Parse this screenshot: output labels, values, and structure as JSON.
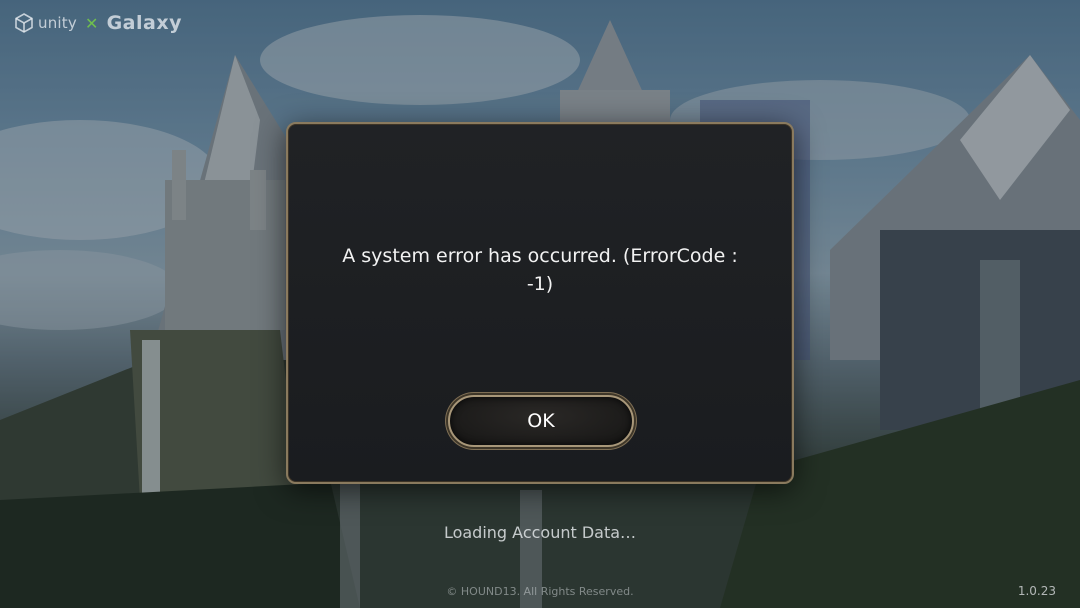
{
  "logo": {
    "unity_text": "unity",
    "separator": "✕",
    "galaxy_text": "Galaxy"
  },
  "dialog": {
    "message_line1": "A system error has occurred. (ErrorCode :",
    "message_line2": "-1)",
    "ok_label": "OK"
  },
  "status": {
    "loading_text": "Loading Account Data…"
  },
  "footer": {
    "copyright": "© HOUND13. All Rights Reserved.",
    "version": "1.0.23"
  },
  "colors": {
    "dialog_border": "#8a7a5e",
    "dialog_bg": "#1d1f22",
    "accent_x": "#6fbf4e"
  }
}
